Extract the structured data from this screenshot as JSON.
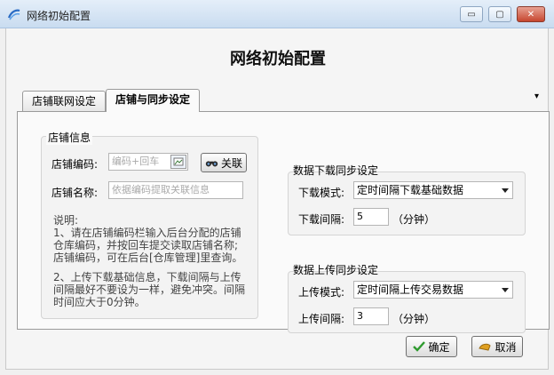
{
  "window": {
    "title": "网络初始配置",
    "minimize": "▭",
    "maximize": "▢",
    "close": "✕"
  },
  "heading": "网络初始配置",
  "tabs": [
    {
      "label": "店铺联网设定",
      "active": false
    },
    {
      "label": "店铺与同步设定",
      "active": true
    }
  ],
  "tab_menu_glyph": "▾",
  "store_info": {
    "title": "店铺信息",
    "code_label": "店铺编码:",
    "code_placeholder": "编码+回车",
    "link_button": "关联",
    "name_label": "店铺名称:",
    "name_placeholder": "依据编码提取关联信息",
    "notes": [
      "说明:",
      "1、请在店铺编码栏输入后台分配的店铺",
      "仓库编码，并按回车提交读取店铺名称;",
      "店铺编码，可在后台[仓库管理]里查询。",
      "",
      "2、上传下载基础信息，下载间隔与上传",
      "间隔最好不要设为一样，避免冲突。间隔",
      "时间应大于0分钟。"
    ]
  },
  "download_sync": {
    "title": "数据下载同步设定",
    "mode_label": "下载模式:",
    "mode_value": "定时间隔下载基础数据",
    "interval_label": "下载间隔:",
    "interval_value": "5",
    "unit": "（分钟）"
  },
  "upload_sync": {
    "title": "数据上传同步设定",
    "mode_label": "上传模式:",
    "mode_value": "定时间隔上传交易数据",
    "interval_label": "上传间隔:",
    "interval_value": "3",
    "unit": "（分钟）"
  },
  "footer": {
    "ok_label": "确定",
    "cancel_label": "取消"
  },
  "colors": {
    "ok_check": "#2e9a2e",
    "accent": "#2b6cc4"
  }
}
